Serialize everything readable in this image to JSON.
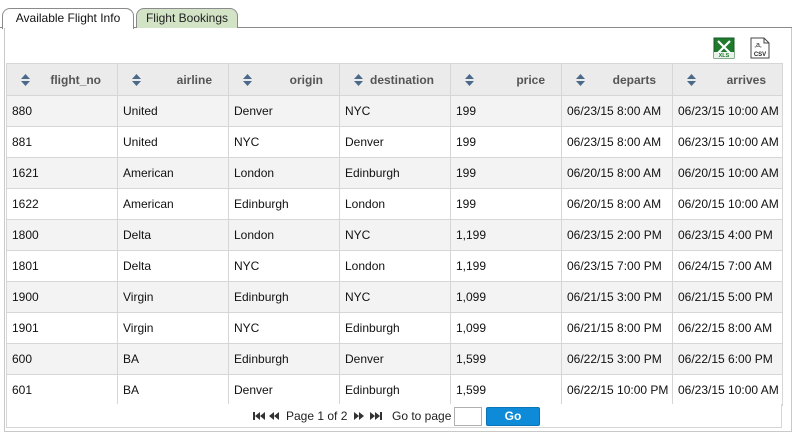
{
  "tabs": [
    {
      "label": "Available Flight Info",
      "active": true
    },
    {
      "label": "Flight Bookings",
      "active": false
    }
  ],
  "export": {
    "xls_icon": "excel-export-icon",
    "csv_icon": "csv-export-icon",
    "xls_text": "XLS",
    "csv_text": "CSV"
  },
  "table": {
    "columns": [
      "flight_no",
      "airline",
      "origin",
      "destination",
      "price",
      "departs",
      "arrives"
    ],
    "rows": [
      [
        "880",
        "United",
        "Denver",
        "NYC",
        "199",
        "06/23/15 8:00 AM",
        "06/23/15 10:00 AM"
      ],
      [
        "881",
        "United",
        "NYC",
        "Denver",
        "199",
        "06/23/15 8:00 AM",
        "06/23/15 10:00 AM"
      ],
      [
        "1621",
        "American",
        "London",
        "Edinburgh",
        "199",
        "06/20/15 8:00 AM",
        "06/20/15 10:00 AM"
      ],
      [
        "1622",
        "American",
        "Edinburgh",
        "London",
        "199",
        "06/20/15 8:00 AM",
        "06/20/15 10:00 AM"
      ],
      [
        "1800",
        "Delta",
        "London",
        "NYC",
        "1,199",
        "06/23/15 2:00 PM",
        "06/23/15 4:00 PM"
      ],
      [
        "1801",
        "Delta",
        "NYC",
        "London",
        "1,199",
        "06/23/15 7:00 PM",
        "06/24/15 7:00 AM"
      ],
      [
        "1900",
        "Virgin",
        "Edinburgh",
        "NYC",
        "1,099",
        "06/21/15 3:00 PM",
        "06/21/15 5:00 PM"
      ],
      [
        "1901",
        "Virgin",
        "NYC",
        "Edinburgh",
        "1,099",
        "06/21/15 8:00 PM",
        "06/22/15 8:00 AM"
      ],
      [
        "600",
        "BA",
        "Edinburgh",
        "Denver",
        "1,599",
        "06/22/15 3:00 PM",
        "06/22/15 6:00 PM"
      ],
      [
        "601",
        "BA",
        "Denver",
        "Edinburgh",
        "1,599",
        "06/22/15 10:00 PM",
        "06/23/15 10:00 AM"
      ]
    ]
  },
  "pager": {
    "page_text": "Page 1 of 2",
    "goto_label": "Go to page",
    "goto_value": "",
    "go_label": "Go"
  },
  "colors": {
    "active_tab_bg": "#ffffff",
    "inactive_tab_bg": "#d2e3c6",
    "header_bg": "#ebebeb",
    "go_button": "#0e8bd8",
    "xls_green": "#1f7a2e"
  }
}
